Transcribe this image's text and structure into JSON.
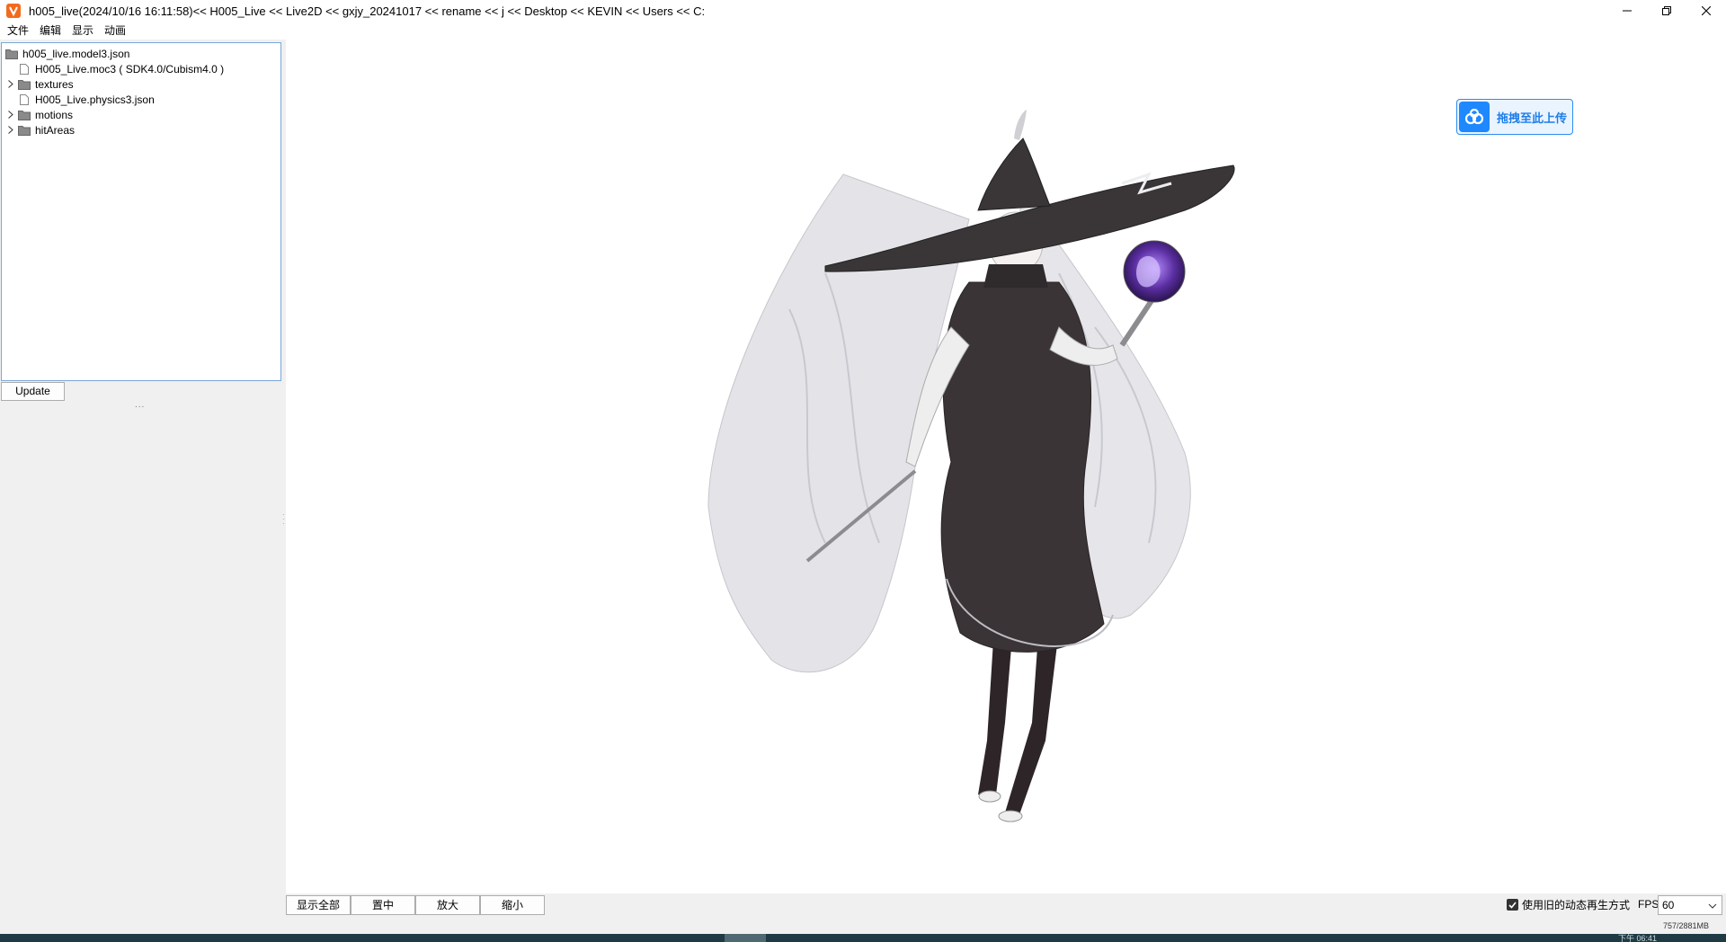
{
  "window": {
    "title": "h005_live(2024/10/16 16:11:58)<< H005_Live << Live2D << gxjy_20241017 << rename << j << Desktop << KEVIN << Users << C:"
  },
  "menu": [
    "文件",
    "编辑",
    "显示",
    "动画"
  ],
  "tree": {
    "root": "h005_live.model3.json",
    "items": [
      {
        "label": "H005_Live.moc3 ( SDK4.0/Cubism4.0 )",
        "type": "file",
        "expandable": false
      },
      {
        "label": "textures",
        "type": "folder",
        "expandable": true
      },
      {
        "label": "H005_Live.physics3.json",
        "type": "file",
        "expandable": false
      },
      {
        "label": "motions",
        "type": "folder",
        "expandable": true
      },
      {
        "label": "hitAreas",
        "type": "folder",
        "expandable": true
      }
    ]
  },
  "left_panel": {
    "update_label": "Update",
    "dots": "..."
  },
  "upload": {
    "label": "拖拽至此上传"
  },
  "toolbar": {
    "show_all": "显示全部",
    "center": "置中",
    "zoom_in": "放大",
    "zoom_out": "缩小",
    "legacy_option_label": "使用旧的动态再生方式",
    "legacy_option_checked": true,
    "fps_label": "FPS",
    "fps_value": "60",
    "memory": "757/2881MB"
  },
  "taskbar": {
    "clock": "下午 06:41"
  },
  "colors": {
    "accent": "#2d8cf0",
    "tree_border": "#7aa7d9",
    "taskbar": "#1f3a44"
  }
}
